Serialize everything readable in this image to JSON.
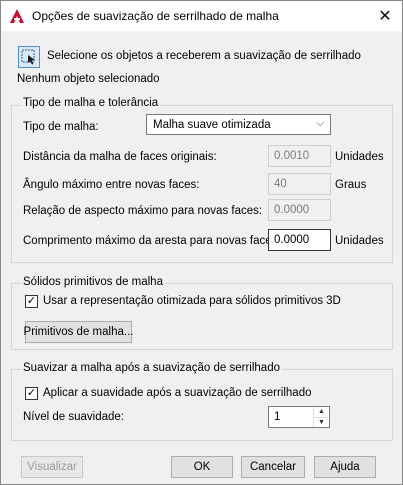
{
  "window": {
    "title": "Opções de suavização de serrilhado de malha",
    "close_glyph": "✕"
  },
  "selection": {
    "button_label": "Selecione os objetos a receberem a suavização de serrilhado",
    "status": "Nenhum objeto selecionado"
  },
  "mesh_type_group": {
    "title": "Tipo de malha e tolerância",
    "mesh_type_label": "Tipo de malha:",
    "mesh_type_value": "Malha suave otimizada",
    "distance_label": "Distância da malha de faces originais:",
    "distance_value": "0.0010",
    "distance_unit": "Unidades",
    "angle_label": "Ângulo máximo entre novas faces:",
    "angle_value": "40",
    "angle_unit": "Graus",
    "aspect_label": "Relação de aspecto máximo para novas faces:",
    "aspect_value": "0.0000",
    "edge_label": "Comprimento máximo da aresta para novas faces:",
    "edge_value": "0.0000",
    "edge_unit": "Unidades"
  },
  "primitives_group": {
    "title": "Sólidos primitivos de malha",
    "checkbox_label": "Usar a representação otimizada para sólidos primitivos 3D",
    "checked": true,
    "button_label": "Primitivos de malha..."
  },
  "smooth_group": {
    "title": "Suavizar a malha após a suavização de serrilhado",
    "checkbox_label": "Aplicar a suavidade após a suavização de serrilhado",
    "checked": true,
    "level_label": "Nível de suavidade:",
    "level_value": "1"
  },
  "footer": {
    "preview": "Visualizar",
    "ok": "OK",
    "cancel": "Cancelar",
    "help": "Ajuda"
  },
  "colors": {
    "app_icon": "#c8102e",
    "selection_button_border": "#4a90d9",
    "dialog_background": "#f0f0f0"
  },
  "icons": {
    "app": "autocad-logo-icon",
    "select": "select-objects-icon",
    "close": "close-icon",
    "combo": "chevron-down-icon",
    "check": "checkmark-icon"
  }
}
